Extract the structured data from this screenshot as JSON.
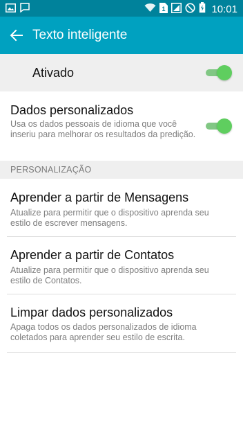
{
  "status_bar": {
    "time": "10:01",
    "icons": [
      "gallery-notification-icon",
      "message-notification-icon",
      "wifi-icon",
      "sim-icon",
      "signal-icon",
      "no-disturb-icon",
      "battery-icon"
    ]
  },
  "app_bar": {
    "back_icon": "arrow-left-icon",
    "title": "Texto inteligente"
  },
  "master_switch": {
    "label": "Ativado",
    "on": true
  },
  "personal_data": {
    "title": "Dados personalizados",
    "description": "Usa os dados pessoais de idioma que você inseriu para melhorar os resultados da predição.",
    "on": true
  },
  "section": {
    "label": "PERSONALIZAÇÃO"
  },
  "items": [
    {
      "title": "Aprender a partir de Mensagens",
      "description": "Atualize para permitir que o dispositivo aprenda seu estilo de escrever mensagens."
    },
    {
      "title": "Aprender a partir de Contatos",
      "description": "Atualize para permitir que o dispositivo aprenda seu estilo de Contatos."
    },
    {
      "title": "Limpar dados personalizados",
      "description": "Apaga todos os dados personalizados de idioma coletados para aprender seu estilo de escrita."
    }
  ],
  "colors": {
    "status_bar": "#00829b",
    "app_bar": "#00a1c0",
    "toggle_on": "#5fce5f"
  }
}
